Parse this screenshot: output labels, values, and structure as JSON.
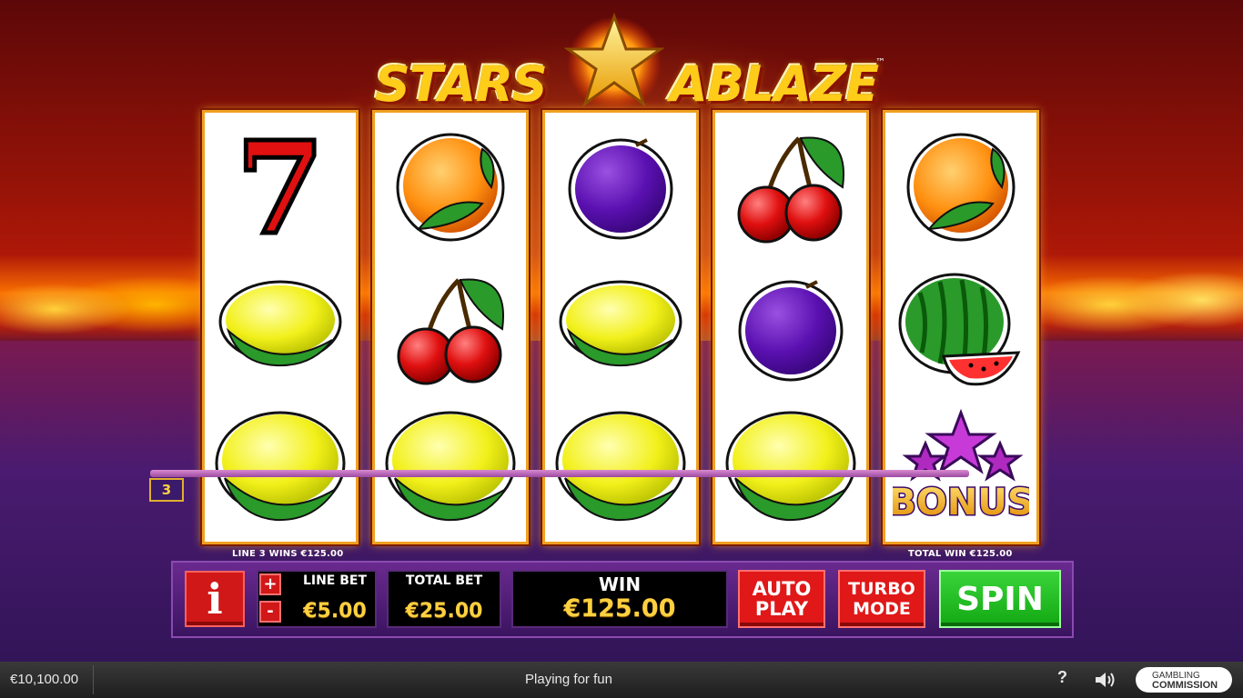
{
  "game": {
    "logo_left": "STARS",
    "logo_right": "ABLAZE",
    "logo_tm": "™"
  },
  "reels": [
    {
      "symbols": [
        "seven-icon",
        "lemon-icon",
        "lemon-icon"
      ]
    },
    {
      "symbols": [
        "orange-icon",
        "cherries-icon",
        "lemon-icon"
      ]
    },
    {
      "symbols": [
        "plum-icon",
        "lemon-icon",
        "lemon-icon"
      ]
    },
    {
      "symbols": [
        "cherries-icon",
        "plum-icon",
        "lemon-icon"
      ]
    },
    {
      "symbols": [
        "orange-icon",
        "watermelon-icon",
        "bonus-icon"
      ]
    }
  ],
  "bonus_label": "BONUS",
  "seven_label": "7",
  "payline": {
    "number": "3"
  },
  "messages": {
    "line_win": "LINE 3 WINS €125.00",
    "total_win": "TOTAL WIN €125.00"
  },
  "controls": {
    "info_label": "i",
    "plus_label": "+",
    "minus_label": "-",
    "line_bet_label": "LINE BET",
    "line_bet_value": "€5.00",
    "total_bet_label": "TOTAL BET",
    "total_bet_value": "€25.00",
    "win_label": "WIN",
    "win_value": "€125.00",
    "auto_play_line1": "AUTO",
    "auto_play_line2": "PLAY",
    "turbo_line1": "TURBO",
    "turbo_line2": "MODE",
    "spin_label": "SPIN"
  },
  "status_bar": {
    "balance": "€10,100.00",
    "mode": "Playing for fun",
    "help": "?",
    "gc_line1": "GAMBLING",
    "gc_line2": "COMMISSION"
  },
  "colors": {
    "accent_gold": "#ffd040",
    "spin_green": "#22bb22",
    "button_red": "#e01818",
    "panel_purple": "#4a1a70"
  }
}
